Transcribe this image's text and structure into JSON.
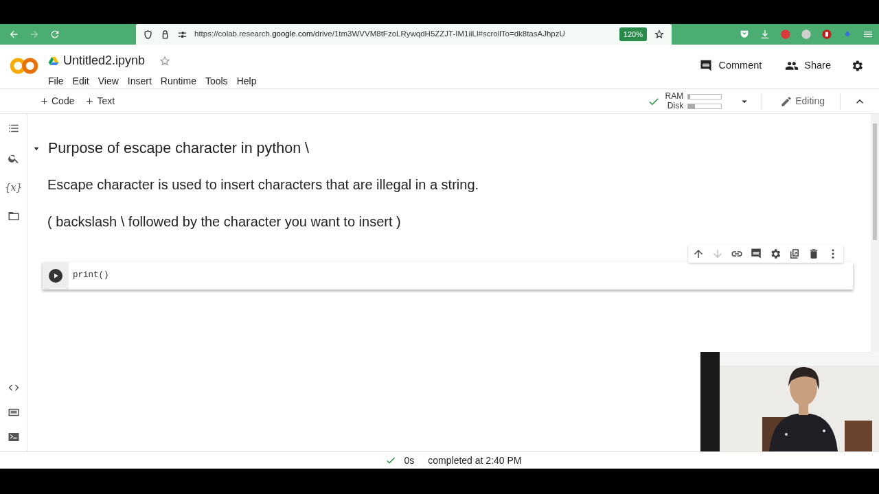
{
  "browser": {
    "url": "https://colab.research.**google.com**/drive/1tm3WVVM8tFzoLRywqdH5ZZJT-IM1iiLl#scrollTo=dk8tasAJhpzU",
    "zoom": "120%"
  },
  "notebook": {
    "title": "Untitled2.ipynb",
    "starred": false
  },
  "menu": [
    "File",
    "Edit",
    "View",
    "Insert",
    "Runtime",
    "Tools",
    "Help"
  ],
  "header_actions": [
    {
      "label": "Comment",
      "kind": "comment"
    },
    {
      "label": "Share",
      "kind": "share"
    }
  ],
  "toolbar": {
    "add": [
      "Code",
      "Text"
    ],
    "resources": [
      {
        "label": "RAM",
        "level": 0.05
      },
      {
        "label": "Disk",
        "level": 0.2
      }
    ],
    "mode": "Editing"
  },
  "sidebar": [
    {
      "kind": "toc"
    },
    {
      "kind": "search"
    },
    {
      "kind": "variables",
      "label": "{x}"
    },
    {
      "kind": "folder"
    }
  ],
  "sidebar_bottom": [
    {
      "kind": "code"
    },
    {
      "kind": "snippets"
    },
    {
      "kind": "terminal"
    }
  ],
  "text_cell": {
    "heading": "Purpose of escape character in python \\",
    "expanded": true,
    "paragraphs": [
      "Escape character is used to insert characters that are illegal in a string.",
      "( backslash \\ followed by the character you want to insert )"
    ]
  },
  "code_cell": {
    "code": "print()"
  },
  "cell_tools": [
    {
      "kind": "up",
      "disabled": false
    },
    {
      "kind": "down",
      "disabled": true
    },
    {
      "kind": "link",
      "disabled": false
    },
    {
      "kind": "comment",
      "disabled": false
    },
    {
      "kind": "settings",
      "disabled": false
    },
    {
      "kind": "mirror",
      "disabled": false
    },
    {
      "kind": "delete",
      "disabled": false
    },
    {
      "kind": "more",
      "disabled": false
    }
  ],
  "status": {
    "time": "0s",
    "message": "completed at 2:40 PM"
  },
  "video_overlay": {
    "kind": "picture"
  }
}
